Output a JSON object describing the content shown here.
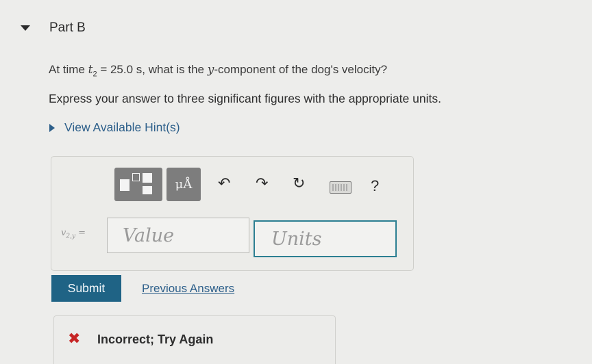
{
  "part": {
    "title": "Part B"
  },
  "question": {
    "prefix": "At time ",
    "time_var": "t",
    "time_sub": "2",
    "time_value": " = 25.0 s, what is the ",
    "component_var": "y",
    "suffix": "-component of the dog's velocity?"
  },
  "instructions": "Express your answer to three significant figures with the appropriate units.",
  "hint": {
    "label": "View Available Hint(s)",
    "icon": "triangle-right-icon"
  },
  "toolbar": {
    "templates_icon": "templates-icon",
    "units_symbol": "μÅ",
    "undo_glyph": "↶",
    "redo_glyph": "↷",
    "reset_glyph": "↻",
    "keyboard_icon": "keyboard-icon",
    "help_glyph": "?"
  },
  "answer": {
    "var_main": "v",
    "var_sub": "2,y",
    "equals": " =",
    "value_placeholder": "Value",
    "units_placeholder": "Units"
  },
  "actions": {
    "submit_label": "Submit",
    "previous_answers_label": "Previous Answers"
  },
  "feedback": {
    "icon_glyph": "✖",
    "text": "Incorrect; Try Again",
    "status_color": "#c62525"
  },
  "colors": {
    "link": "#2d5f8a",
    "primary_button": "#1f6385",
    "units_focus_border": "#2c7f92"
  }
}
